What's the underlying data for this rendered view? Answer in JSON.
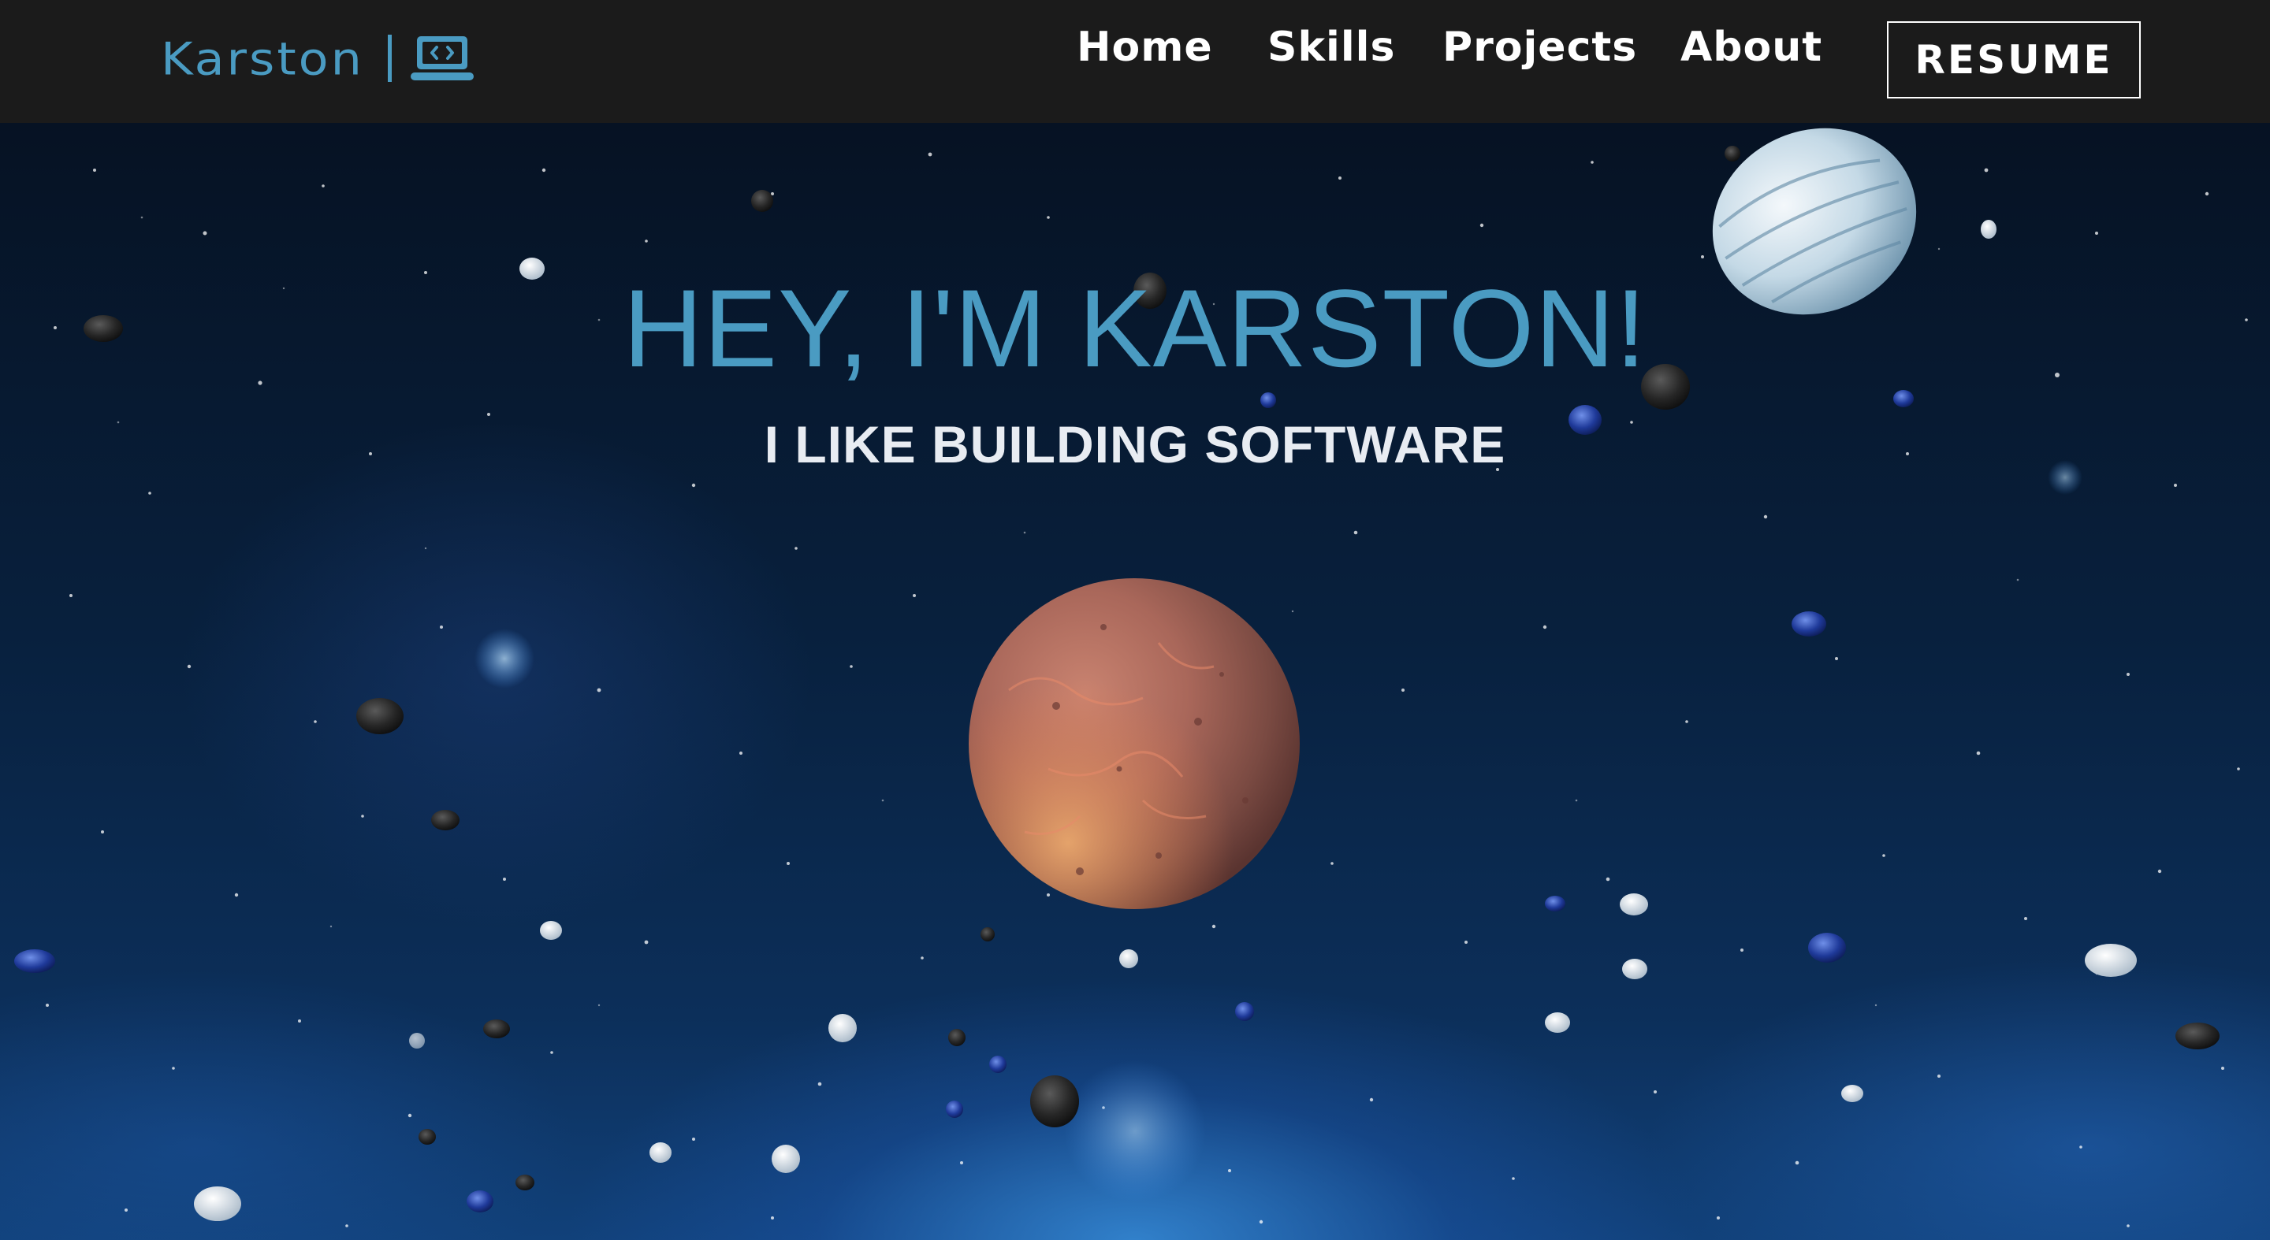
{
  "nav": {
    "brand": "Karston",
    "brand_icon": "laptop-code-icon",
    "links": [
      "Home",
      "Skills",
      "Projects",
      "About"
    ],
    "resume_label": "RESUME"
  },
  "hero": {
    "title": "HEY, I'M KARSTON!",
    "subtitle": "I LIKE BUILDING SOFTWARE"
  },
  "colors": {
    "accent": "#4a9bc2",
    "navbar_bg": "#1b1b1b",
    "space_bg": "#071426"
  }
}
